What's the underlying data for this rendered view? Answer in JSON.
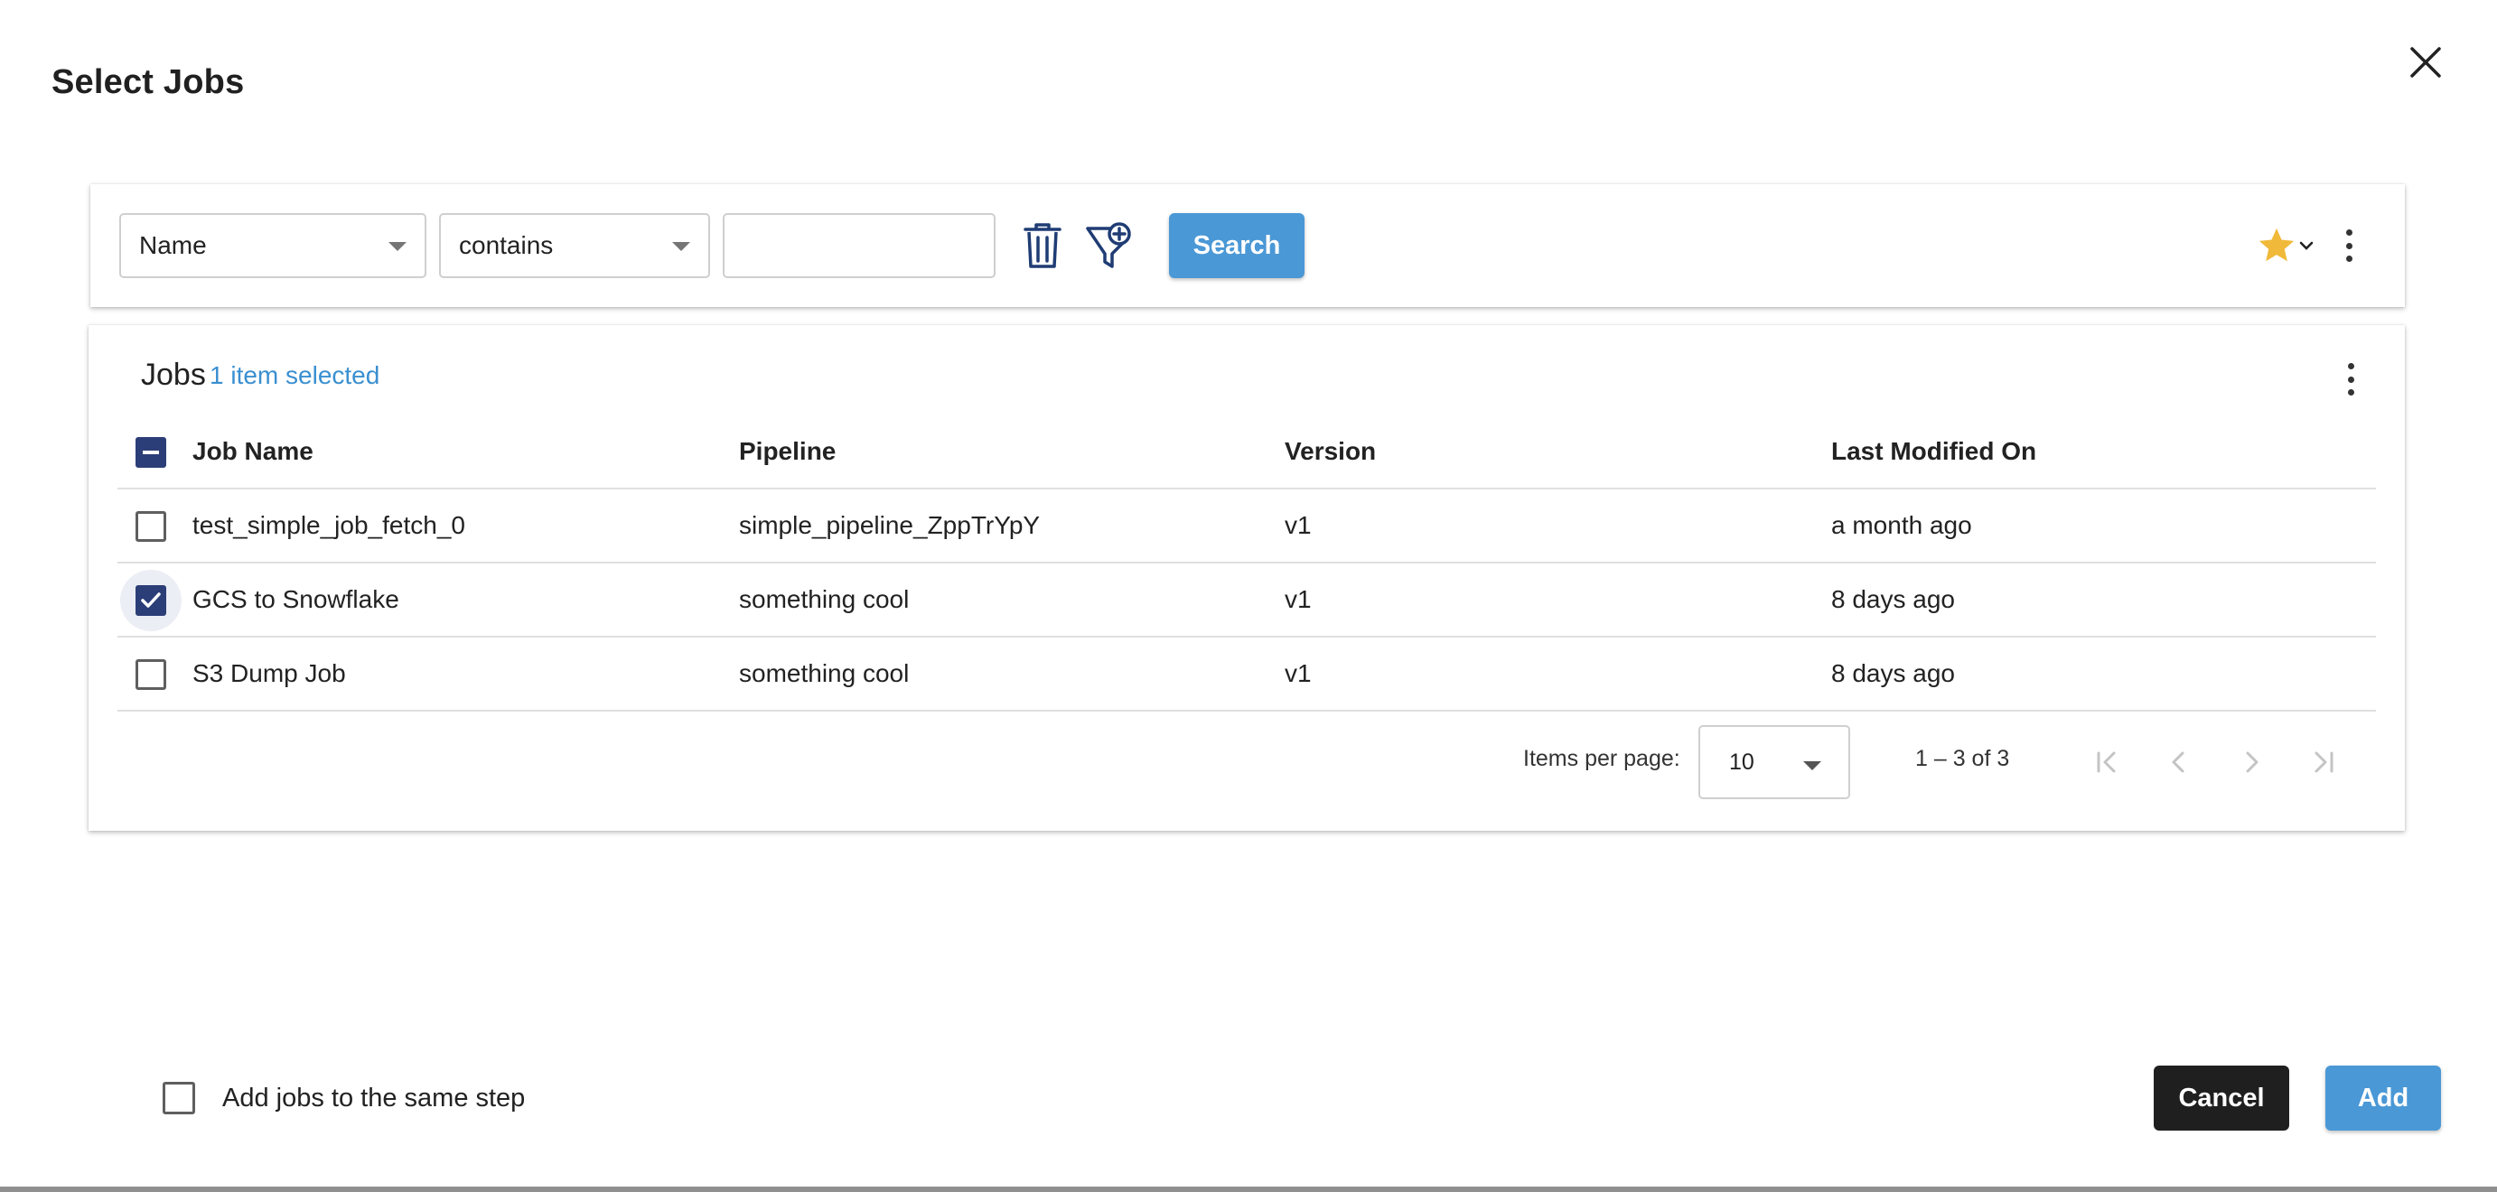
{
  "dialog": {
    "title": "Select Jobs"
  },
  "filter": {
    "field_value": "Name",
    "operator_value": "contains",
    "text_value": "",
    "search_label": "Search"
  },
  "jobs": {
    "title": "Jobs",
    "selection_text": "1 item selected",
    "columns": [
      "Job Name",
      "Pipeline",
      "Version",
      "Last Modified On"
    ],
    "rows": [
      {
        "name": "test_simple_job_fetch_0",
        "pipeline": "simple_pipeline_ZppTrYpY",
        "version": "v1",
        "modified": "a month ago",
        "checked": false
      },
      {
        "name": "GCS to Snowflake",
        "pipeline": "something cool",
        "version": "v1",
        "modified": "8 days ago",
        "checked": true
      },
      {
        "name": "S3 Dump Job",
        "pipeline": "something cool",
        "version": "v1",
        "modified": "8 days ago",
        "checked": false
      }
    ]
  },
  "paginator": {
    "items_per_page_label": "Items per page:",
    "page_size": "10",
    "range_label": "1 – 3 of 3"
  },
  "footer": {
    "same_step_label": "Add jobs to the same step",
    "cancel_label": "Cancel",
    "add_label": "Add"
  },
  "colors": {
    "primary": "#4a98d6",
    "checkbox_checked": "#2c3e77",
    "star": "#f0b93a",
    "icon_dark": "#1f3c74"
  }
}
